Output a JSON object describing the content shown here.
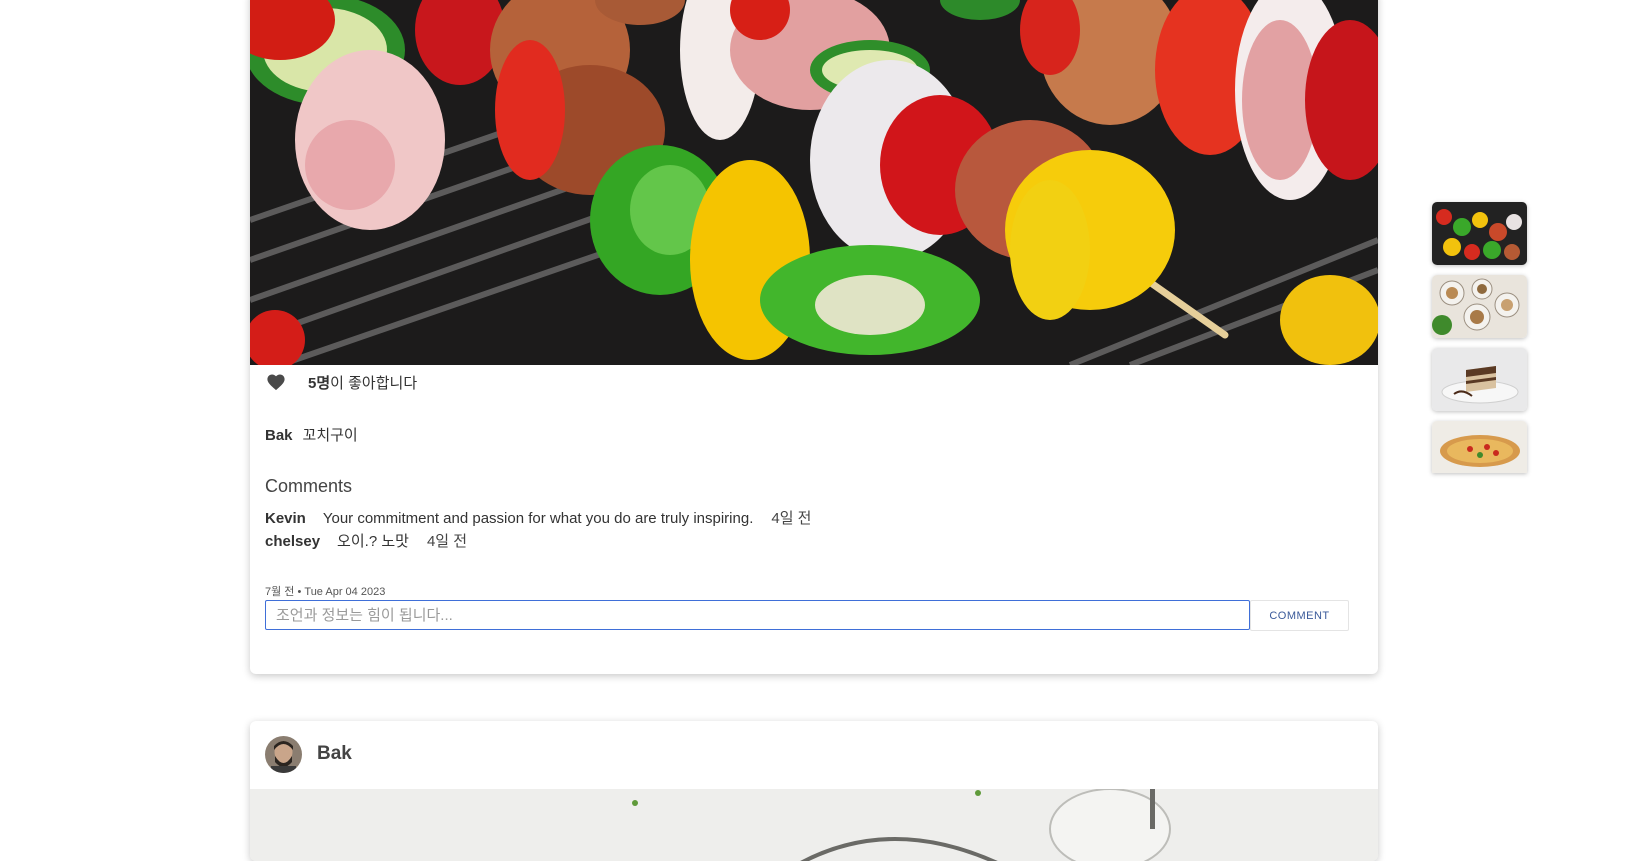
{
  "post": {
    "image_alt": "꼬치구이",
    "likes_count": "5명",
    "likes_suffix": "이 좋아합니다",
    "author": "Bak",
    "caption": "꼬치구이",
    "comments_title": "Comments",
    "comments": [
      {
        "user": "Kevin",
        "text": "Your commitment and passion for what you do are truly inspiring.",
        "time": "4일 전"
      },
      {
        "user": "chelsey",
        "text": "오이.? 노맛",
        "time": "4일 전"
      }
    ],
    "timestamp": "7월 전 • Tue Apr 04 2023",
    "comment_input_placeholder": "조언과 정보는 힘이 됩니다...",
    "comment_button_label": "COMMENT"
  },
  "next_post": {
    "author": "Bak"
  },
  "thumbnails": [
    {
      "name": "skewer-thumbnail"
    },
    {
      "name": "salad-bowls-thumbnail"
    },
    {
      "name": "cake-slice-thumbnail"
    },
    {
      "name": "pizza-thumbnail"
    }
  ],
  "colors": {
    "accent": "#3f6fd8",
    "heart": "#4a4a4a"
  }
}
